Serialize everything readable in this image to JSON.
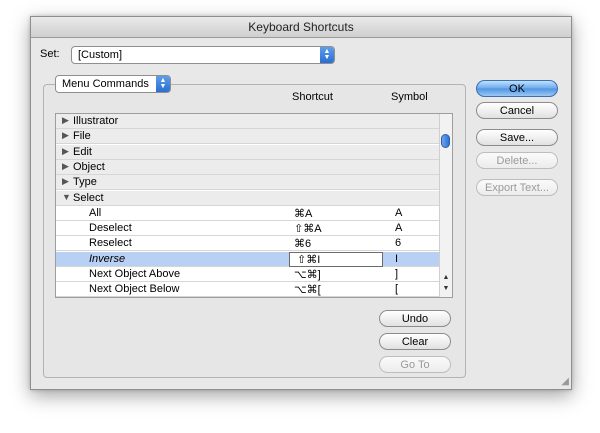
{
  "window": {
    "title": "Keyboard Shortcuts"
  },
  "set": {
    "label": "Set:",
    "value": "[Custom]"
  },
  "group": {
    "selector": "Menu Commands"
  },
  "table": {
    "columns": {
      "shortcut": "Shortcut",
      "symbol": "Symbol"
    },
    "rows": [
      {
        "type": "category",
        "expanded": false,
        "name": "Illustrator",
        "shortcut": "",
        "symbol": ""
      },
      {
        "type": "category",
        "expanded": false,
        "name": "File",
        "shortcut": "",
        "symbol": ""
      },
      {
        "type": "category",
        "expanded": false,
        "name": "Edit",
        "shortcut": "",
        "symbol": ""
      },
      {
        "type": "category",
        "expanded": false,
        "name": "Object",
        "shortcut": "",
        "symbol": ""
      },
      {
        "type": "category",
        "expanded": false,
        "name": "Type",
        "shortcut": "",
        "symbol": ""
      },
      {
        "type": "category",
        "expanded": true,
        "name": "Select",
        "shortcut": "",
        "symbol": ""
      },
      {
        "type": "item",
        "name": "All",
        "shortcut": "⌘A",
        "symbol": "A"
      },
      {
        "type": "item",
        "name": "Deselect",
        "shortcut": "⇧⌘A",
        "symbol": "A"
      },
      {
        "type": "item",
        "name": "Reselect",
        "shortcut": "⌘6",
        "symbol": "6"
      },
      {
        "type": "item",
        "selected": true,
        "name": "Inverse",
        "shortcut": "⇧⌘I",
        "symbol": "I"
      },
      {
        "type": "item",
        "name": "Next Object Above",
        "shortcut": "⌥⌘]",
        "symbol": "]"
      },
      {
        "type": "item",
        "name": "Next Object Below",
        "shortcut": "⌥⌘[",
        "symbol": "["
      }
    ]
  },
  "buttons": {
    "ok": "OK",
    "cancel": "Cancel",
    "save": "Save...",
    "delete": "Delete...",
    "export": "Export Text...",
    "undo": "Undo",
    "clear": "Clear",
    "goto": "Go To"
  },
  "icons": {
    "collapsed": "▶",
    "expanded": "▼",
    "popup_arrows": "▲▼",
    "scroll_up": "▲",
    "scroll_down": "▼",
    "resize_grip": "◢"
  },
  "colors": {
    "accent": "#3b82e0",
    "selection": "#b7d0f4"
  }
}
